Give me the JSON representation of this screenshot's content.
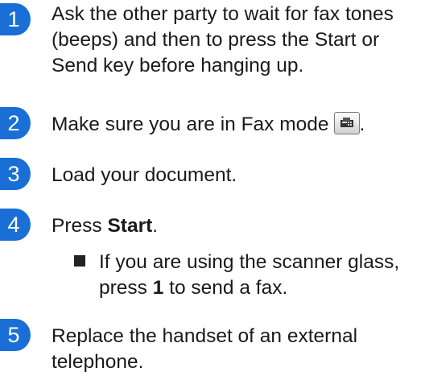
{
  "steps": [
    {
      "number": "1",
      "text": "Ask the other party to wait for fax tones (beeps) and then to press the Start or Send key before hanging up."
    },
    {
      "number": "2",
      "text": "Make sure you are in Fax mode",
      "after_icon": ".",
      "icon": "fax-mode-key-icon"
    },
    {
      "number": "3",
      "text": "Load your document."
    },
    {
      "number": "4",
      "text_before": "Press ",
      "bold": "Start",
      "text_after": "."
    },
    {
      "number": "5",
      "text": "Replace the handset of an external telephone."
    }
  ],
  "bullet": {
    "text_before": "If you are using the scanner glass, press ",
    "bold": "1",
    "text_after": " to send a fax."
  },
  "colors": {
    "step_badge": "#1a6fd6",
    "text": "#1a1a1a"
  }
}
